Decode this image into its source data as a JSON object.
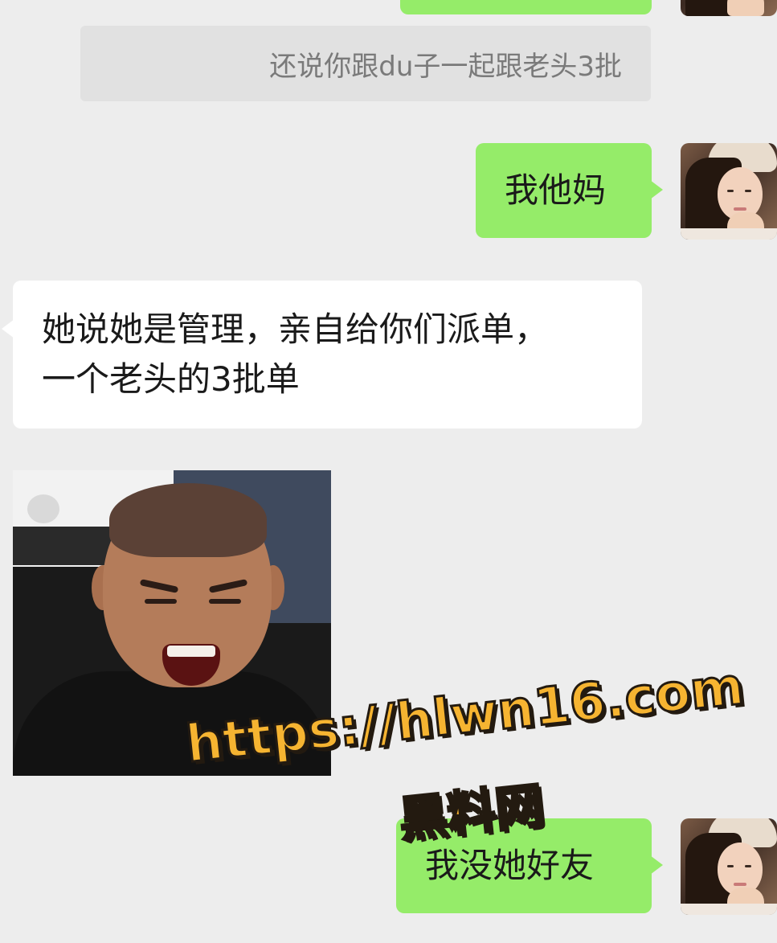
{
  "messages": {
    "quote_text": "还说你跟du子一起跟老头3批",
    "outgoing_1": "我他妈",
    "incoming_1_line1": "她说她是管理，亲自给你们派单，",
    "incoming_1_line2": "一个老头的3批单",
    "outgoing_2": "我没她好友"
  },
  "sticker": {
    "icon": "laughing-face-sticker"
  },
  "watermark": {
    "url": "https://hlwn16.com",
    "site_name": "黑料网"
  },
  "colors": {
    "background": "#ededed",
    "outgoing_bubble": "#95ec69",
    "incoming_bubble": "#ffffff",
    "watermark": "#f6b431"
  }
}
